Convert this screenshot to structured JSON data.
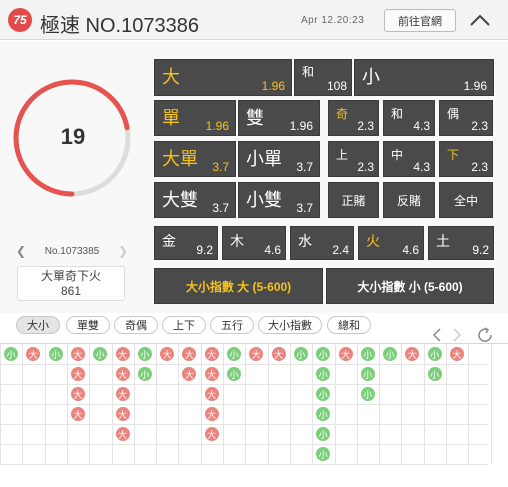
{
  "header": {
    "logo_text": "75",
    "title": "極速 NO.1073386",
    "datetime": "Apr 12.20:23",
    "site_button": "前往官網",
    "collapse_icon": "chevron-up-icon"
  },
  "countdown": {
    "value": "19",
    "progress_fraction": 0.72,
    "color": "#e5544f",
    "track_color": "#dddddd"
  },
  "previous": {
    "label": "No.1073385",
    "result_text": "大單奇下火",
    "sum": "861"
  },
  "bets": {
    "row1": [
      {
        "label": "大",
        "odds": "1.96"
      },
      {
        "label": "和",
        "odds": "108"
      },
      {
        "label": "小",
        "odds": "1.96"
      }
    ],
    "row2": [
      {
        "label": "單",
        "odds": "1.96"
      },
      {
        "label": "雙",
        "odds": "1.96"
      },
      {
        "label": "奇",
        "odds": "2.3"
      },
      {
        "label": "和",
        "odds": "4.3"
      },
      {
        "label": "偶",
        "odds": "2.3"
      }
    ],
    "row3": [
      {
        "label": "大單",
        "odds": "3.7"
      },
      {
        "label": "小單",
        "odds": "3.7"
      },
      {
        "label": "上",
        "odds": "2.3"
      },
      {
        "label": "中",
        "odds": "4.3"
      },
      {
        "label": "下",
        "odds": "2.3"
      }
    ],
    "row4": [
      {
        "label": "大雙",
        "odds": "3.7"
      },
      {
        "label": "小雙",
        "odds": "3.7"
      },
      {
        "label": "正賭"
      },
      {
        "label": "反賭"
      },
      {
        "label": "全中"
      }
    ],
    "row5": [
      {
        "label": "金",
        "odds": "9.2"
      },
      {
        "label": "木",
        "odds": "4.6"
      },
      {
        "label": "水",
        "odds": "2.4"
      },
      {
        "label": "火",
        "odds": "4.6"
      },
      {
        "label": "土",
        "odds": "9.2"
      }
    ],
    "index_big": "大小指數 大 (5-600)",
    "index_small": "大小指數 小 (5-600)",
    "highlight_color": "#f6c21c"
  },
  "tabs": [
    "大小",
    "單雙",
    "奇偶",
    "上下",
    "五行",
    "大小指數",
    "總和"
  ],
  "active_tab": "大小",
  "trend": {
    "legend": {
      "big": "大",
      "small": "小"
    },
    "columns": [
      [
        "小"
      ],
      [
        "大"
      ],
      [
        "小"
      ],
      [
        "大",
        "大",
        "大",
        "大"
      ],
      [
        "小"
      ],
      [
        "大",
        "大",
        "大",
        "大",
        "大"
      ],
      [
        "小",
        "小"
      ],
      [
        "大"
      ],
      [
        "大",
        "大"
      ],
      [
        "大",
        "大",
        "大",
        "大",
        "大"
      ],
      [
        "小",
        "小"
      ],
      [
        "大"
      ],
      [
        "大"
      ],
      [
        "小"
      ],
      [
        "小",
        "小",
        "小",
        "小",
        "小",
        "小"
      ],
      [
        "大"
      ],
      [
        "小",
        "小",
        "小"
      ],
      [
        "小"
      ],
      [
        "大"
      ],
      [
        "小",
        "小"
      ],
      [
        "大"
      ]
    ]
  }
}
